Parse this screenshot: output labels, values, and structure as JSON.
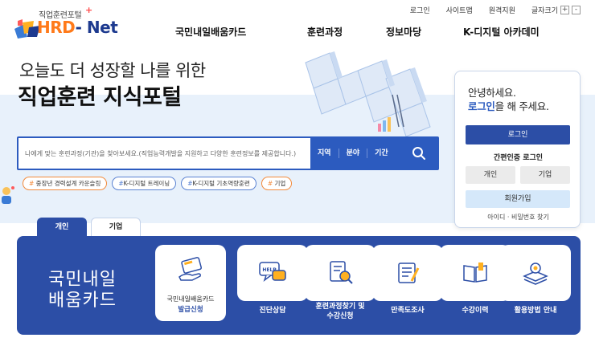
{
  "header": {
    "logo_sub": "직업훈련포털",
    "logo_main_a": "HRD",
    "logo_main_b": "- Net",
    "logo_plus": "+",
    "util": {
      "login": "로그인",
      "sitemap": "사이트맵",
      "remote": "원격지원",
      "font_size": "글자크기",
      "font_plus": "+",
      "font_minus": "-"
    },
    "gnb": [
      "국민내일배움카드",
      "훈련과정",
      "정보마당",
      "K-디지털 아카데미"
    ]
  },
  "hero": {
    "line1": "오늘도 더 성장할 나를 위한",
    "line2": "직업훈련 지식포털"
  },
  "search": {
    "placeholder": "나에게 맞는 훈련과정(기관)을 찾아보세요.(직업능력개발을 지원하고 다양한 훈련정보를 제공합니다.)",
    "filters": [
      "지역",
      "분야",
      "기간"
    ]
  },
  "tags": [
    {
      "hash": "#",
      "label": " 중장년 경력설계 카운슬링"
    },
    {
      "hash": "#",
      "label": "K-디지털 트레이닝"
    },
    {
      "hash": "#",
      "label": "K-디지털 기초역량훈련"
    },
    {
      "hash": "#",
      "label": " 기업"
    }
  ],
  "login_panel": {
    "greet1": "안녕하세요.",
    "greet2_hl": "로그인",
    "greet2_rest": "을 해 주세요.",
    "login_button": "로그인",
    "simple_auth": "간편인증 로그인",
    "individual": "개인",
    "corporate": "기업",
    "join": "회원가입",
    "find": "아이디 · 비밀번호 찾기"
  },
  "tabs": [
    "개인",
    "기업"
  ],
  "main_panel": {
    "title1": "국민내일",
    "title2": "배움카드",
    "card_main_line1": "국민내일배움카드",
    "card_main_line2": "발급신청",
    "cards": [
      {
        "label": "진단상담"
      },
      {
        "label1": "훈련과정찾기 및",
        "label2": "수강신청"
      },
      {
        "label": "만족도조사"
      },
      {
        "label": "수강이력"
      },
      {
        "label": "활용방법 안내"
      }
    ],
    "help_badge": "HELP"
  },
  "colors": {
    "primary": "#2c4ea6",
    "search_blue": "#2c5bbf",
    "accent_orange": "#ff7a1a",
    "band": "#e8f1fb"
  }
}
